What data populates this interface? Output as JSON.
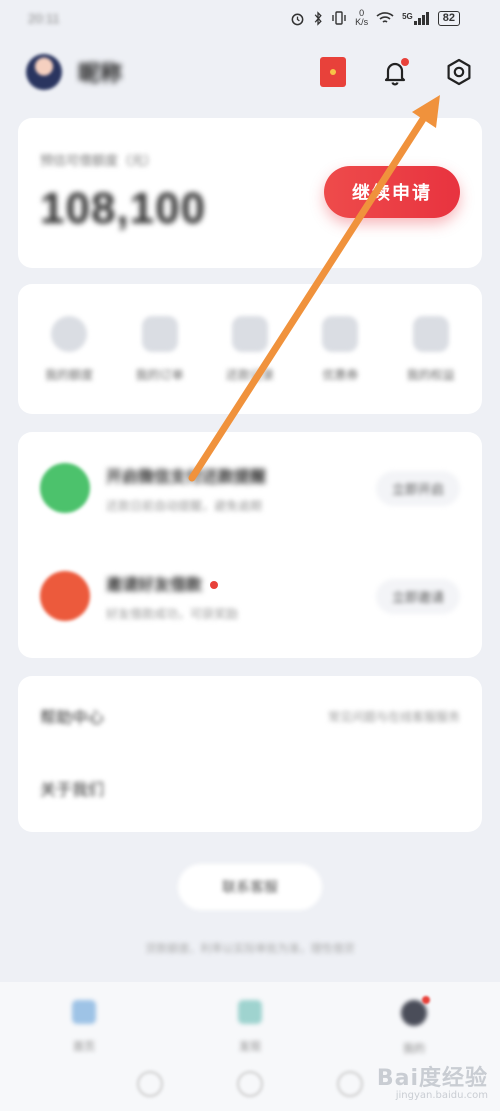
{
  "status_bar": {
    "time": "20:11",
    "speed_value": "0",
    "speed_unit": "K/s",
    "network": "5G",
    "battery": "82"
  },
  "header": {
    "user_name": "昵称"
  },
  "balance_card": {
    "label": "预估可借额度（元）",
    "value": "108,100",
    "button_label": "继续申请"
  },
  "quick_actions": [
    {
      "label": "我的额度",
      "icon": "quota-icon"
    },
    {
      "label": "我的订单",
      "icon": "order-icon"
    },
    {
      "label": "还款记录",
      "icon": "repay-icon"
    },
    {
      "label": "优惠券",
      "icon": "coupon-icon"
    },
    {
      "label": "我的权益",
      "icon": "benefit-icon"
    }
  ],
  "promo_list": [
    {
      "title": "开启微信支付还款提醒",
      "subtitle": "还款日前自动提醒，避免逾期",
      "action": "立即开启",
      "color": "#4cc26c"
    },
    {
      "title": "邀请好友借款",
      "subtitle": "好友借款成功，可获奖励",
      "action": "立即邀请",
      "color": "#ec5a3c",
      "hot": true
    }
  ],
  "links": [
    {
      "label": "帮助中心",
      "value": "常见问题与在线客服服务"
    },
    {
      "label": "关于我们",
      "value": ""
    }
  ],
  "service_button": "联系客服",
  "footer_note": "贷款额度、利率以实际审批为准，理性借贷",
  "bottom_nav": [
    {
      "label": "首页"
    },
    {
      "label": "发现"
    },
    {
      "label": "我的",
      "badge": true
    }
  ],
  "watermark": {
    "main": "Bai度经验",
    "sub": "jingyan.baidu.com"
  },
  "colors": {
    "accent": "#e8333f",
    "annotation_arrow": "#f0923c"
  }
}
